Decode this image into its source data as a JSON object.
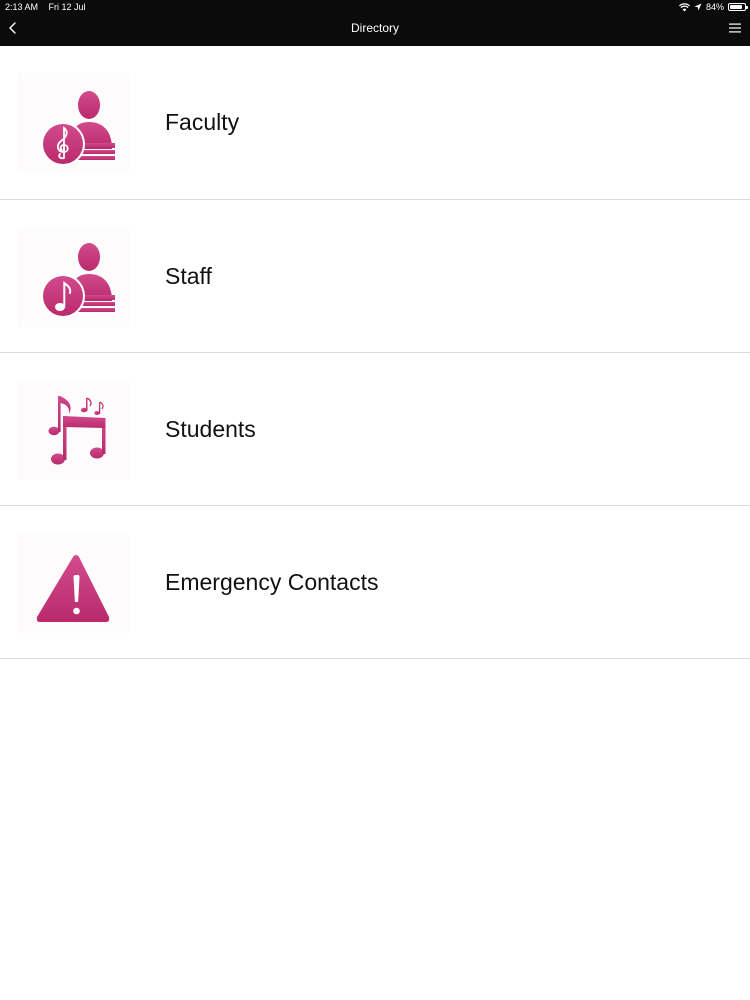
{
  "status_bar": {
    "time": "2:13 AM",
    "date": "Fri 12 Jul",
    "battery": "84%",
    "battery_level": 0.84
  },
  "nav": {
    "title": "Directory",
    "back_icon": "chevron-left-icon",
    "menu_icon": "hamburger-menu-icon"
  },
  "theme": {
    "bar_color": "#0b0b0b",
    "accent": "#c8347a",
    "divider": "#dcdcdc"
  },
  "directory": {
    "items": [
      {
        "label": "Faculty",
        "icon": "faculty-person-treble-clef-icon"
      },
      {
        "label": "Staff",
        "icon": "staff-person-music-note-icon"
      },
      {
        "label": "Students",
        "icon": "music-notes-icon"
      },
      {
        "label": "Emergency Contacts",
        "icon": "warning-triangle-icon"
      }
    ]
  }
}
